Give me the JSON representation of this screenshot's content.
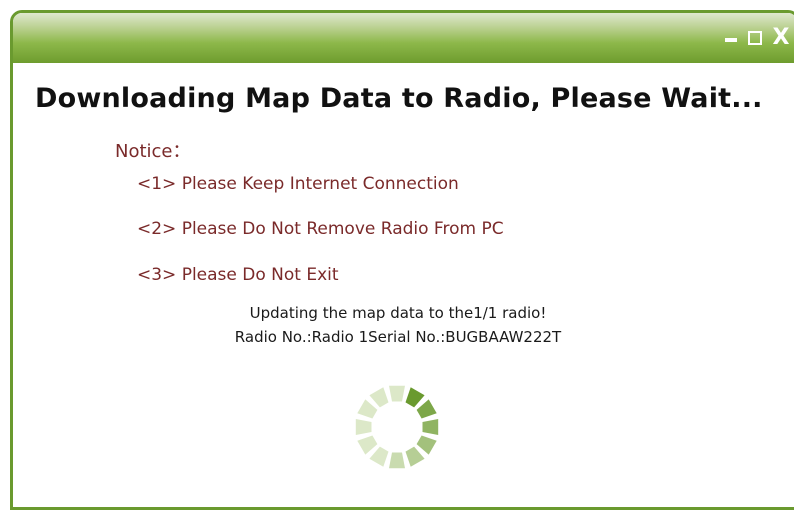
{
  "window": {
    "controls": {
      "minimize_icon": "minimize-icon",
      "maximize_icon": "maximize-icon",
      "close_label": "X"
    }
  },
  "main": {
    "heading": "Downloading Map Data to Radio, Please Wait...",
    "notice_title": "Notice：",
    "notice_items": [
      "<1> Please Keep Internet Connection",
      "<2> Please Do Not Remove Radio From PC",
      "<3> Please Do Not Exit"
    ],
    "status_line_1": "Updating the map data to the1/1 radio!",
    "status_line_2": "Radio No.:Radio 1Serial No.:BUGBAAW222T"
  },
  "colors": {
    "titlebar_green": "#6e9c2e",
    "border_green": "#6a9a2f",
    "notice_text": "#7a2a2a",
    "spinner_dark": "#6a9a2f",
    "spinner_light": "#dce8c8"
  }
}
